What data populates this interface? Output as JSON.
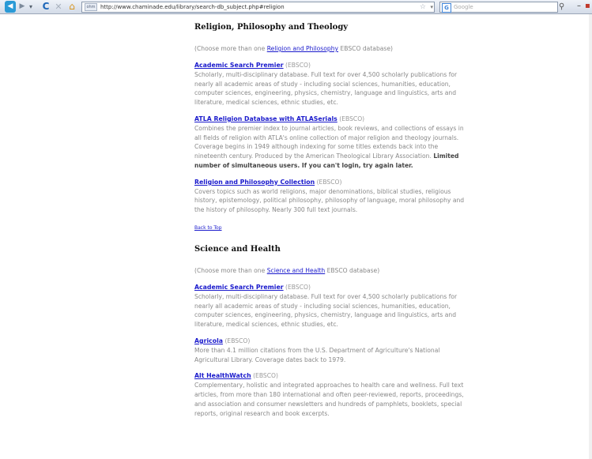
{
  "browser": {
    "url": "http://www.chaminade.edu/library/search-db_subject.php#religion",
    "url_badge": "ohm",
    "search_placeholder": "Google",
    "search_engine_letter": "G"
  },
  "sections": [
    {
      "title": "Religion, Philosophy and Theology",
      "choose_prefix": "(Choose more than one ",
      "choose_link": "Religion and Philosophy",
      "choose_suffix": " EBSCO database)",
      "entries": [
        {
          "title": "Academic Search Premier",
          "vendor": "(EBSCO)",
          "desc": "Scholarly, multi-disciplinary database. Full text for over 4,500 scholarly publications for nearly all academic areas of study - including social sciences, humanities, education, computer sciences, engineering, physics, chemistry, language and linguistics, arts and literature, medical sciences, ethnic studies, etc.",
          "strong": ""
        },
        {
          "title": "ATLA Religion Database with ATLASerials",
          "vendor": "(EBSCO)",
          "desc": "Combines the premier index to journal articles, book reviews, and collections of essays in all fields of religion with ATLA's online collection of major religion and theology journals. Coverage begins in 1949 although indexing for some titles extends back into the nineteenth century. Produced by the American Theological Library Association. ",
          "strong": "Limited number of simultaneous users. If you can't login, try again later."
        },
        {
          "title": "Religion and Philosophy Collection",
          "vendor": "(EBSCO)",
          "desc": "Covers topics such as world religions, major denominations, biblical studies, religious history, epistemology, political philosophy, philosophy of language, moral philosophy and the history of philosophy. Nearly 300 full text journals.",
          "strong": ""
        }
      ],
      "back_to_top": "Back to Top"
    },
    {
      "title": "Science and Health",
      "choose_prefix": "(Choose more than one ",
      "choose_link": "Science and Health",
      "choose_suffix": " EBSCO database)",
      "entries": [
        {
          "title": "Academic Search Premier",
          "vendor": "(EBSCO)",
          "desc": "Scholarly, multi-disciplinary database. Full text for over 4,500 scholarly publications for nearly all academic areas of study - including social sciences, humanities, education, computer sciences, engineering, physics, chemistry, language and linguistics, arts and literature, medical sciences, ethnic studies, etc.",
          "strong": ""
        },
        {
          "title": "Agricola",
          "vendor": "(EBSCO)",
          "desc": "More than 4.1 million citations from the U.S. Department of Agriculture's National Agricultural Library. Coverage dates back to 1979.",
          "strong": ""
        },
        {
          "title": "Alt HealthWatch",
          "vendor": "(EBSCO)",
          "desc": "Complementary, holistic and integrated approaches to health care and wellness. Full text articles, from more than 180 international and often peer-reviewed, reports, proceedings, and association and consumer newsletters and hundreds of pamphlets, booklets, special reports, original research and book excerpts.",
          "strong": ""
        }
      ]
    }
  ]
}
